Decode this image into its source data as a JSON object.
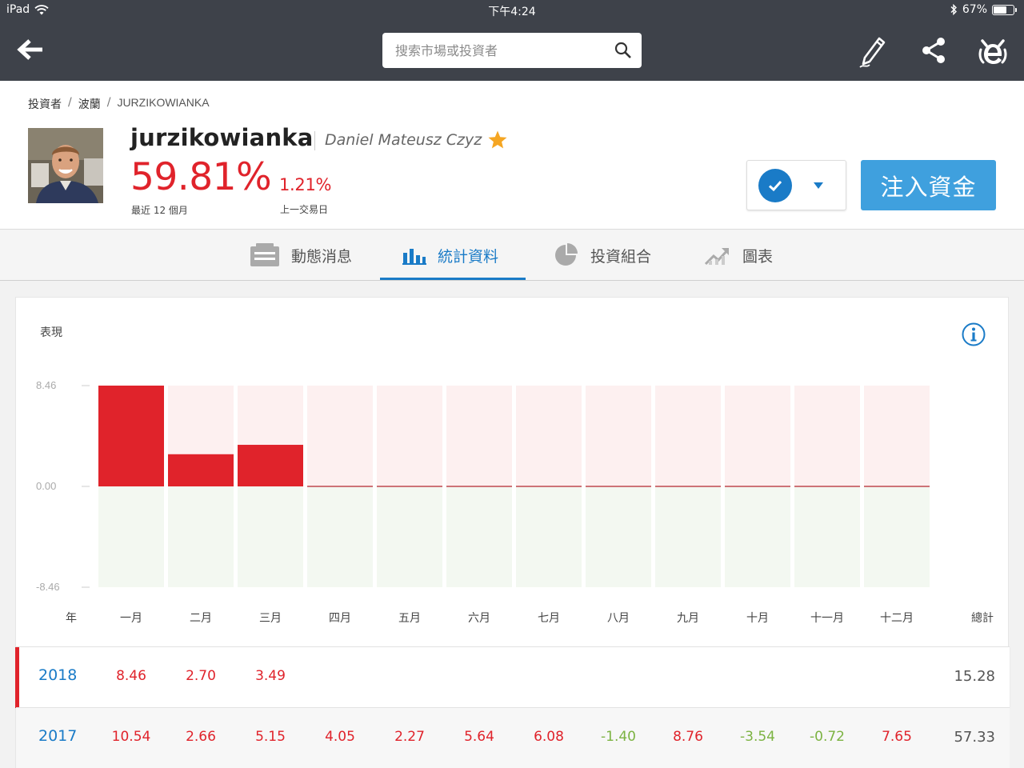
{
  "status_bar": {
    "device": "iPad",
    "time": "下午4:24",
    "battery": "67%",
    "battery_level": 0.67
  },
  "nav": {
    "search_placeholder": "搜索市場或投資者"
  },
  "breadcrumb": {
    "items": [
      "投資者",
      "波蘭",
      "JURZIKOWIANKA"
    ],
    "separator": "/"
  },
  "profile": {
    "username": "jurzikowianka",
    "full_name": "Daniel Mateusz Czyz",
    "gain_12m": "59.81%",
    "gain_12m_label": "最近 12 個月",
    "gain_day": "1.21%",
    "gain_day_label": "上一交易日",
    "invest_label": "注入資金"
  },
  "tabs": [
    {
      "label": "動態消息",
      "icon": "news-feed-icon",
      "active": false
    },
    {
      "label": "統計資料",
      "icon": "bar-chart-icon",
      "active": true
    },
    {
      "label": "投資組合",
      "icon": "pie-chart-icon",
      "active": false
    },
    {
      "label": "圖表",
      "icon": "trend-chart-icon",
      "active": false
    }
  ],
  "performance": {
    "title": "表現",
    "year_header": "年",
    "total_header": "總計",
    "months": [
      "一月",
      "二月",
      "三月",
      "四月",
      "五月",
      "六月",
      "七月",
      "八月",
      "九月",
      "十月",
      "十一月",
      "十二月"
    ],
    "years": [
      {
        "year": "2018",
        "values": [
          "8.46",
          "2.70",
          "3.49",
          "",
          "",
          "",
          "",
          "",
          "",
          "",
          "",
          ""
        ],
        "total": "15.28",
        "selected": true
      },
      {
        "year": "2017",
        "values": [
          "10.54",
          "2.66",
          "5.15",
          "4.05",
          "2.27",
          "5.64",
          "6.08",
          "-1.40",
          "8.76",
          "-3.54",
          "-0.72",
          "7.65"
        ],
        "total": "57.33",
        "selected": false
      }
    ]
  },
  "chart_data": {
    "type": "bar",
    "title": "表現",
    "categories": [
      "一月",
      "二月",
      "三月",
      "四月",
      "五月",
      "六月",
      "七月",
      "八月",
      "九月",
      "十月",
      "十一月",
      "十二月"
    ],
    "series": [
      {
        "name": "2018",
        "values": [
          8.46,
          2.7,
          3.49,
          0,
          0,
          0,
          0,
          0,
          0,
          0,
          0,
          0
        ]
      }
    ],
    "ylim": [
      -8.46,
      8.46
    ],
    "yticks": [
      "8.46",
      "0.00",
      "-8.46"
    ],
    "grid": false,
    "colors": {
      "bar": "#e0232b",
      "positive_bg": "#fdf0f0",
      "negative_bg": "#f3f8f1",
      "zero_line": "#c0494f"
    }
  },
  "colors": {
    "topbar": "#3e424a",
    "accent_blue": "#1a7bc7",
    "invest_button": "#3fa0de",
    "gain_red": "#e0232b",
    "loss_green": "#7cb342",
    "star": "#f5a623"
  }
}
